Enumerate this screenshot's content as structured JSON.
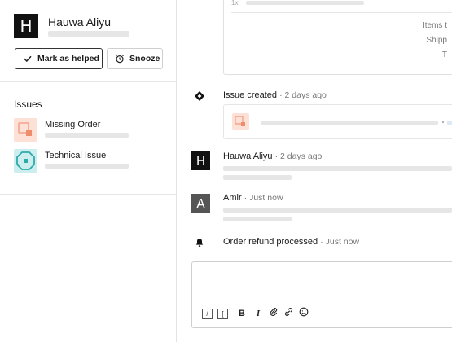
{
  "customer": {
    "avatar_letter": "H",
    "name": "Hauwa Aliyu"
  },
  "actions": {
    "helped_label": "Mark as helped",
    "snooze_label": "Snooze"
  },
  "issues": {
    "title": "Issues",
    "items": [
      {
        "label": "Missing Order",
        "icon": "missing-order-icon",
        "color": "#fde1d7",
        "accent": "#f08a6c"
      },
      {
        "label": "Technical Issue",
        "icon": "technical-issue-icon",
        "color": "#cdeeef",
        "accent": "#2fa9a9"
      }
    ]
  },
  "order": {
    "qty": "1x",
    "items_total_label": "Items t",
    "shipping_label": "Shipp",
    "total_label": "T"
  },
  "timeline": [
    {
      "type": "event",
      "icon": "diamond-icon",
      "title": "Issue created",
      "meta": "· 2 days ago"
    },
    {
      "type": "message",
      "avatar_letter": "H",
      "avatar_color": "#111111",
      "title": "Hauwa Aliyu",
      "meta": "· 2 days ago"
    },
    {
      "type": "message",
      "avatar_letter": "A",
      "avatar_color": "#555555",
      "title": "Amir",
      "meta": "· Just now"
    },
    {
      "type": "event",
      "icon": "bell-icon",
      "title": "Order refund processed",
      "meta": "· Just now"
    }
  ],
  "composer": {
    "toolbar": [
      {
        "name": "slash-command-icon",
        "glyph": "/"
      },
      {
        "name": "bracket-icon",
        "glyph": "["
      },
      {
        "name": "bold-icon",
        "glyph": "B"
      },
      {
        "name": "italic-icon",
        "glyph": "I"
      },
      {
        "name": "attachment-icon",
        "glyph": ""
      },
      {
        "name": "link-icon",
        "glyph": ""
      },
      {
        "name": "emoji-icon",
        "glyph": ""
      }
    ]
  }
}
